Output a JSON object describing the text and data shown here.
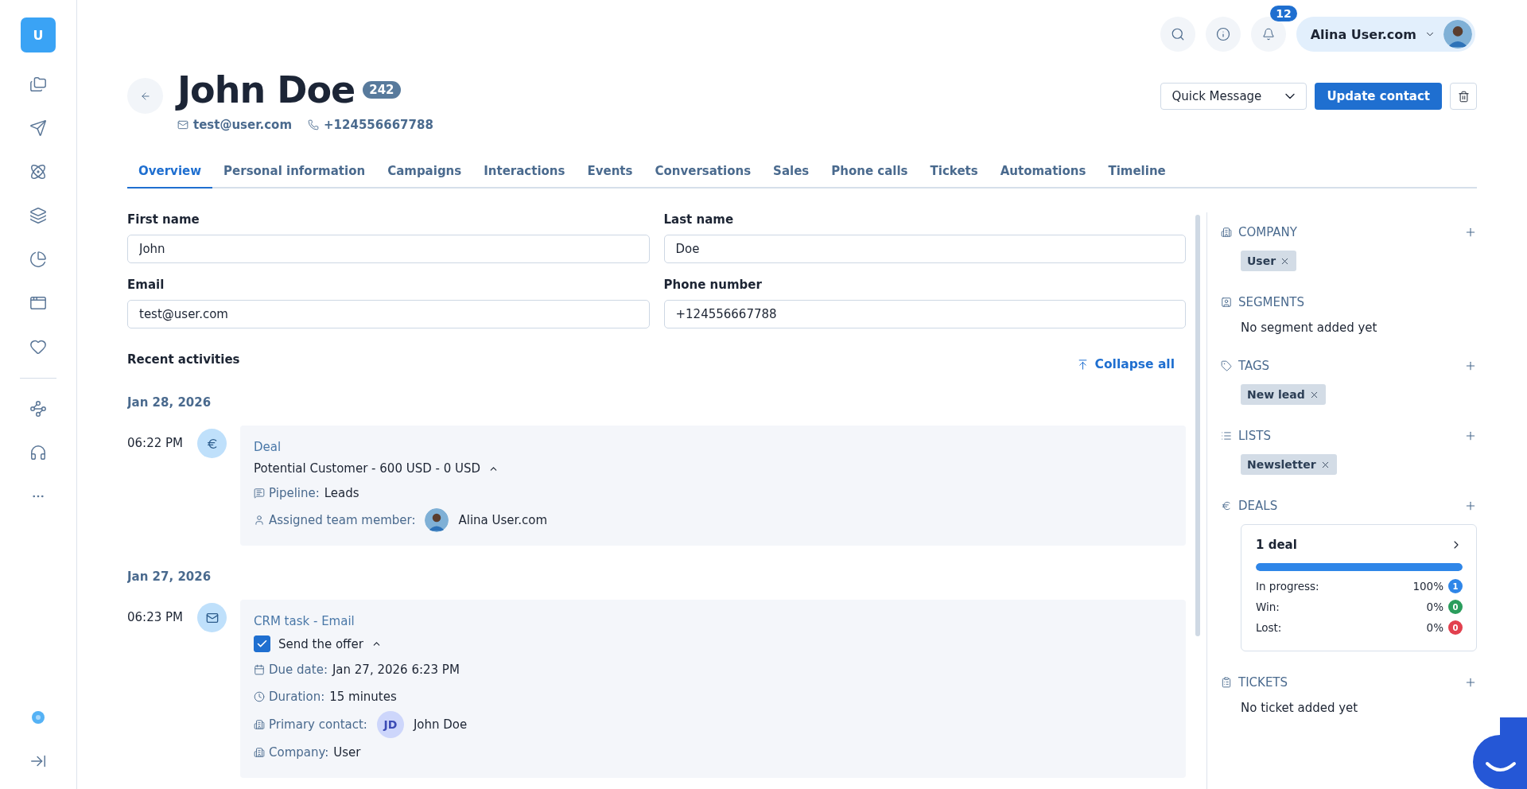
{
  "sidebar": {
    "logo": "U"
  },
  "topbar": {
    "notification_count": "12",
    "user_name": "Alina User.com"
  },
  "contact": {
    "name": "John Doe",
    "id_badge": "242",
    "email": "test@user.com",
    "phone": "+124556667788"
  },
  "actions": {
    "quick_message": "Quick Message",
    "update": "Update contact"
  },
  "tabs": [
    {
      "label": "Overview",
      "selected": true
    },
    {
      "label": "Personal information",
      "selected": false
    },
    {
      "label": "Campaigns",
      "selected": false
    },
    {
      "label": "Interactions",
      "selected": false
    },
    {
      "label": "Events",
      "selected": false
    },
    {
      "label": "Conversations",
      "selected": false
    },
    {
      "label": "Sales",
      "selected": false
    },
    {
      "label": "Phone calls",
      "selected": false
    },
    {
      "label": "Tickets",
      "selected": false
    },
    {
      "label": "Automations",
      "selected": false
    },
    {
      "label": "Timeline",
      "selected": false
    }
  ],
  "form": [
    {
      "label": "First name",
      "value": "John"
    },
    {
      "label": "Last name",
      "value": "Doe"
    },
    {
      "label": "Email",
      "value": "test@user.com"
    },
    {
      "label": "Phone number",
      "value": "+124556667788"
    }
  ],
  "activities": {
    "title": "Recent activities",
    "collapse": "Collapse all",
    "groups": [
      {
        "date": "Jan 28, 2026",
        "items": [
          {
            "time": "06:22 PM",
            "kind": "deal",
            "heading": "Deal",
            "summary": "Potential Customer - 600 USD - 0 USD",
            "expanded": true,
            "details": [
              {
                "kind": "pipeline",
                "label": "Pipeline:",
                "value": "Leads"
              },
              {
                "kind": "assignee",
                "label": "Assigned team member:",
                "value": "Alina User.com"
              }
            ]
          }
        ]
      },
      {
        "date": "Jan 27, 2026",
        "items": [
          {
            "time": "06:23 PM",
            "kind": "task",
            "heading": "CRM task - Email",
            "summary": "Send the offer",
            "checked": true,
            "expanded": true,
            "details": [
              {
                "kind": "due",
                "label": "Due date:",
                "value": "Jan 27, 2026 6:23 PM"
              },
              {
                "kind": "duration",
                "label": "Duration:",
                "value": "15 minutes"
              },
              {
                "kind": "contact",
                "label": "Primary contact:",
                "initials": "JD",
                "value": "John Doe"
              },
              {
                "kind": "company",
                "label": "Company:",
                "value": "User"
              }
            ]
          }
        ]
      }
    ]
  },
  "panel": [
    {
      "kind": "tags",
      "title": "COMPANY",
      "addable": true,
      "tags": [
        "User"
      ]
    },
    {
      "kind": "empty",
      "title": "SEGMENTS",
      "addable": false,
      "text": "No segment added yet"
    },
    {
      "kind": "tags",
      "title": "TAGS",
      "addable": true,
      "tags": [
        "New lead"
      ]
    },
    {
      "kind": "tags",
      "title": "LISTS",
      "addable": true,
      "tags": [
        "Newsletter"
      ]
    },
    {
      "kind": "deals",
      "title": "DEALS",
      "addable": true,
      "card": {
        "title": "1 deal",
        "level": 1,
        "rows": [
          {
            "label": "In progress:",
            "percent": "100%",
            "count": "1",
            "color": "#2f86e8"
          },
          {
            "label": "Win:",
            "percent": "0%",
            "count": "0",
            "color": "#2a9d5c"
          },
          {
            "label": "Lost:",
            "percent": "0%",
            "count": "0",
            "color": "#e2404e"
          }
        ]
      }
    },
    {
      "kind": "empty",
      "title": "TICKETS",
      "addable": true,
      "text": "No ticket added yet"
    }
  ]
}
